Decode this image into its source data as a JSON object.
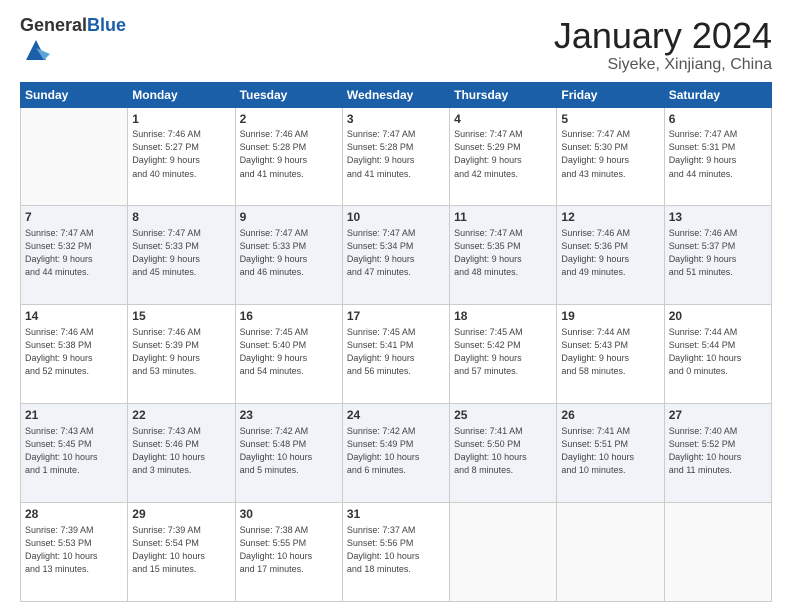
{
  "header": {
    "logo_general": "General",
    "logo_blue": "Blue",
    "month_title": "January 2024",
    "location": "Siyeke, Xinjiang, China"
  },
  "days_of_week": [
    "Sunday",
    "Monday",
    "Tuesday",
    "Wednesday",
    "Thursday",
    "Friday",
    "Saturday"
  ],
  "weeks": [
    [
      {
        "day": "",
        "info": ""
      },
      {
        "day": "1",
        "info": "Sunrise: 7:46 AM\nSunset: 5:27 PM\nDaylight: 9 hours\nand 40 minutes."
      },
      {
        "day": "2",
        "info": "Sunrise: 7:46 AM\nSunset: 5:28 PM\nDaylight: 9 hours\nand 41 minutes."
      },
      {
        "day": "3",
        "info": "Sunrise: 7:47 AM\nSunset: 5:28 PM\nDaylight: 9 hours\nand 41 minutes."
      },
      {
        "day": "4",
        "info": "Sunrise: 7:47 AM\nSunset: 5:29 PM\nDaylight: 9 hours\nand 42 minutes."
      },
      {
        "day": "5",
        "info": "Sunrise: 7:47 AM\nSunset: 5:30 PM\nDaylight: 9 hours\nand 43 minutes."
      },
      {
        "day": "6",
        "info": "Sunrise: 7:47 AM\nSunset: 5:31 PM\nDaylight: 9 hours\nand 44 minutes."
      }
    ],
    [
      {
        "day": "7",
        "info": "Sunrise: 7:47 AM\nSunset: 5:32 PM\nDaylight: 9 hours\nand 44 minutes."
      },
      {
        "day": "8",
        "info": "Sunrise: 7:47 AM\nSunset: 5:33 PM\nDaylight: 9 hours\nand 45 minutes."
      },
      {
        "day": "9",
        "info": "Sunrise: 7:47 AM\nSunset: 5:33 PM\nDaylight: 9 hours\nand 46 minutes."
      },
      {
        "day": "10",
        "info": "Sunrise: 7:47 AM\nSunset: 5:34 PM\nDaylight: 9 hours\nand 47 minutes."
      },
      {
        "day": "11",
        "info": "Sunrise: 7:47 AM\nSunset: 5:35 PM\nDaylight: 9 hours\nand 48 minutes."
      },
      {
        "day": "12",
        "info": "Sunrise: 7:46 AM\nSunset: 5:36 PM\nDaylight: 9 hours\nand 49 minutes."
      },
      {
        "day": "13",
        "info": "Sunrise: 7:46 AM\nSunset: 5:37 PM\nDaylight: 9 hours\nand 51 minutes."
      }
    ],
    [
      {
        "day": "14",
        "info": "Sunrise: 7:46 AM\nSunset: 5:38 PM\nDaylight: 9 hours\nand 52 minutes."
      },
      {
        "day": "15",
        "info": "Sunrise: 7:46 AM\nSunset: 5:39 PM\nDaylight: 9 hours\nand 53 minutes."
      },
      {
        "day": "16",
        "info": "Sunrise: 7:45 AM\nSunset: 5:40 PM\nDaylight: 9 hours\nand 54 minutes."
      },
      {
        "day": "17",
        "info": "Sunrise: 7:45 AM\nSunset: 5:41 PM\nDaylight: 9 hours\nand 56 minutes."
      },
      {
        "day": "18",
        "info": "Sunrise: 7:45 AM\nSunset: 5:42 PM\nDaylight: 9 hours\nand 57 minutes."
      },
      {
        "day": "19",
        "info": "Sunrise: 7:44 AM\nSunset: 5:43 PM\nDaylight: 9 hours\nand 58 minutes."
      },
      {
        "day": "20",
        "info": "Sunrise: 7:44 AM\nSunset: 5:44 PM\nDaylight: 10 hours\nand 0 minutes."
      }
    ],
    [
      {
        "day": "21",
        "info": "Sunrise: 7:43 AM\nSunset: 5:45 PM\nDaylight: 10 hours\nand 1 minute."
      },
      {
        "day": "22",
        "info": "Sunrise: 7:43 AM\nSunset: 5:46 PM\nDaylight: 10 hours\nand 3 minutes."
      },
      {
        "day": "23",
        "info": "Sunrise: 7:42 AM\nSunset: 5:48 PM\nDaylight: 10 hours\nand 5 minutes."
      },
      {
        "day": "24",
        "info": "Sunrise: 7:42 AM\nSunset: 5:49 PM\nDaylight: 10 hours\nand 6 minutes."
      },
      {
        "day": "25",
        "info": "Sunrise: 7:41 AM\nSunset: 5:50 PM\nDaylight: 10 hours\nand 8 minutes."
      },
      {
        "day": "26",
        "info": "Sunrise: 7:41 AM\nSunset: 5:51 PM\nDaylight: 10 hours\nand 10 minutes."
      },
      {
        "day": "27",
        "info": "Sunrise: 7:40 AM\nSunset: 5:52 PM\nDaylight: 10 hours\nand 11 minutes."
      }
    ],
    [
      {
        "day": "28",
        "info": "Sunrise: 7:39 AM\nSunset: 5:53 PM\nDaylight: 10 hours\nand 13 minutes."
      },
      {
        "day": "29",
        "info": "Sunrise: 7:39 AM\nSunset: 5:54 PM\nDaylight: 10 hours\nand 15 minutes."
      },
      {
        "day": "30",
        "info": "Sunrise: 7:38 AM\nSunset: 5:55 PM\nDaylight: 10 hours\nand 17 minutes."
      },
      {
        "day": "31",
        "info": "Sunrise: 7:37 AM\nSunset: 5:56 PM\nDaylight: 10 hours\nand 18 minutes."
      },
      {
        "day": "",
        "info": ""
      },
      {
        "day": "",
        "info": ""
      },
      {
        "day": "",
        "info": ""
      }
    ]
  ]
}
